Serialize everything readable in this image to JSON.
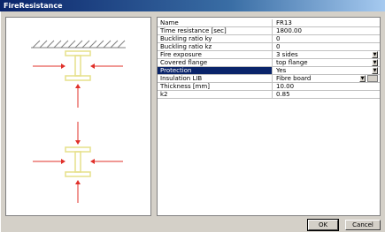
{
  "window": {
    "title": "FireResistance"
  },
  "properties": [
    {
      "label": "Name",
      "value": "FR13"
    },
    {
      "label": "Time resistance [sec]",
      "value": "1800.00"
    },
    {
      "label": "Buckling ratio ky",
      "value": "0"
    },
    {
      "label": "Buckling ratio kz",
      "value": "0"
    },
    {
      "label": "Fire exposure",
      "value": "3 sides"
    },
    {
      "label": "Covered flange",
      "value": "top flange"
    },
    {
      "label": "Protection",
      "value": "Yes"
    },
    {
      "label": "Insulation LIB",
      "value": "Fibre board"
    },
    {
      "label": "Thickness [mm]",
      "value": "10.00"
    },
    {
      "label": "k2",
      "value": "0.85"
    }
  ],
  "buttons": {
    "ok": "OK",
    "cancel": "Cancel"
  },
  "colors": {
    "beam": "#e6e08a",
    "arrows": "#e0302a",
    "selection": "#0a246a"
  }
}
